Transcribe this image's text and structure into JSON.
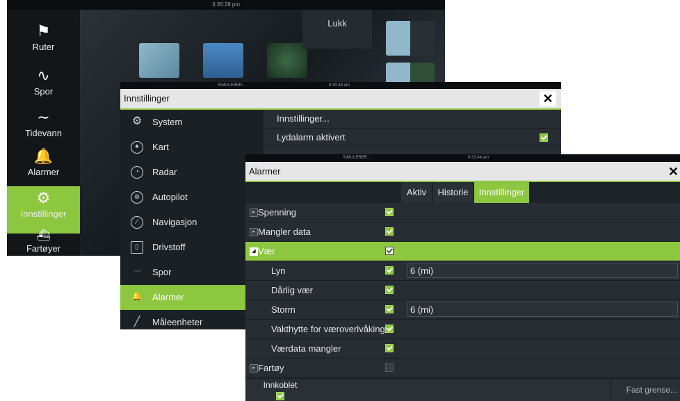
{
  "home": {
    "time": "3:35:28 pm",
    "close_label": "Lukk",
    "sidebar": [
      {
        "label": "Ruter",
        "icon": "routes-flag-icon"
      },
      {
        "label": "Spor",
        "icon": "trails-icon"
      },
      {
        "label": "Tidevann",
        "icon": "tide-wave-icon"
      },
      {
        "label": "Alarmer",
        "icon": "bell-icon"
      },
      {
        "label": "Innstillinger",
        "icon": "gear-icon",
        "active": true
      },
      {
        "label": "Fartøyer",
        "icon": "vessel-icon"
      }
    ]
  },
  "settings": {
    "status_left": "SIMULERER...",
    "time": "8:30:48 am",
    "title": "Innstillinger",
    "menu": [
      {
        "label": "System",
        "icon": "gear-icon"
      },
      {
        "label": "Kart",
        "icon": "chart-globe-icon"
      },
      {
        "label": "Radar",
        "icon": "radar-icon"
      },
      {
        "label": "Autopilot",
        "icon": "autopilot-icon"
      },
      {
        "label": "Navigasjon",
        "icon": "compass-icon"
      },
      {
        "label": "Drivstoff",
        "icon": "fuel-icon"
      },
      {
        "label": "Spor",
        "icon": "trails-icon"
      },
      {
        "label": "Alarmer",
        "icon": "bell-icon",
        "active": true
      },
      {
        "label": "Måleenheter",
        "icon": "ruler-icon"
      }
    ],
    "rows": [
      {
        "label": "Innstillinger...",
        "checked": null
      },
      {
        "label": "Lydalarm aktivert",
        "checked": true
      }
    ]
  },
  "alarms": {
    "status_left": "SIMULERER...",
    "time": "8:31:44 am",
    "title": "Alarmer",
    "tabs": [
      {
        "label": "Aktiv",
        "active": false
      },
      {
        "label": "Historie",
        "active": false
      },
      {
        "label": "Innstillinger",
        "active": true
      }
    ],
    "rows": [
      {
        "label": "Spenning",
        "level": 0,
        "expander": "collapsed",
        "check": "on",
        "value": ""
      },
      {
        "label": "Mangler data",
        "level": 0,
        "expander": "collapsed",
        "check": "on",
        "value": ""
      },
      {
        "label": "Vær",
        "level": 0,
        "expander": "expanded",
        "check": "on",
        "value": "",
        "selected": true
      },
      {
        "label": "Lyn",
        "level": 1,
        "check": "on",
        "value": "6 (mi)"
      },
      {
        "label": "Dårlig vær",
        "level": 1,
        "check": "on",
        "value": ""
      },
      {
        "label": "Storm",
        "level": 1,
        "check": "on",
        "value": "6 (mi)"
      },
      {
        "label": "Vakthytte for væroverlvåking",
        "level": 1,
        "check": "on",
        "value": ""
      },
      {
        "label": "Værdata mangler",
        "level": 1,
        "check": "on",
        "value": ""
      },
      {
        "label": "Fartøy",
        "level": 0,
        "expander": "collapsed",
        "check": "disabled",
        "value": ""
      }
    ],
    "footer": {
      "innkoblet_label": "Innkoblet",
      "innkoblet_checked": true,
      "fast_grense_label": "Fast grense..."
    }
  },
  "colors": {
    "accent": "#8dc63f",
    "panel": "#202529",
    "title_bar": "#e6e6e6"
  }
}
